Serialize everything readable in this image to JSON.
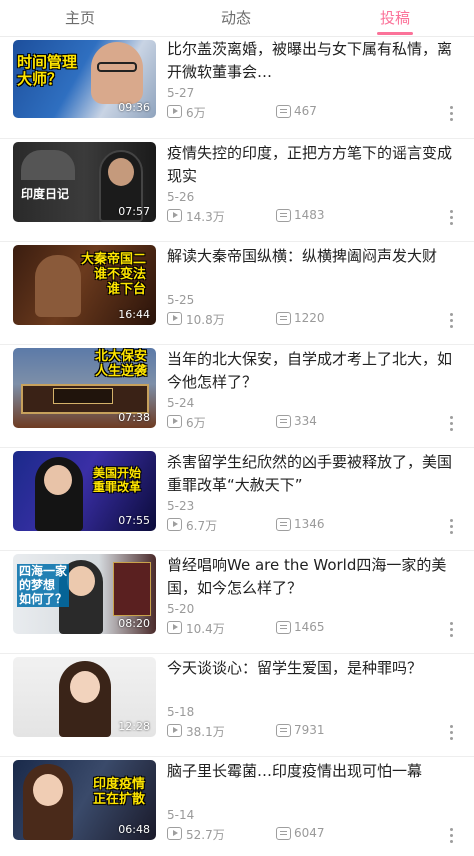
{
  "tabs": [
    {
      "label": "主页"
    },
    {
      "label": "动态"
    },
    {
      "label": "投稿",
      "active": true
    }
  ],
  "accent_color": "#fb7299",
  "videos": [
    {
      "title": "比尔盖茨离婚，被曝出与女下属有私情，离开微软董事会…",
      "date": "5-27",
      "views": "6万",
      "danmaku": "467",
      "duration": "09:36",
      "thumb_caption": "时间管理\n大师？"
    },
    {
      "title": "疫情失控的印度，正把方方笔下的谣言变成现实",
      "date": "5-26",
      "views": "14.3万",
      "danmaku": "1483",
      "duration": "07:57",
      "thumb_caption": "印度日记"
    },
    {
      "title": "解读大秦帝国纵横：纵横捭阖闷声发大财",
      "date": "5-25",
      "views": "10.8万",
      "danmaku": "1220",
      "duration": "16:44",
      "thumb_caption": "大秦帝国二\n谁不变法\n谁下台"
    },
    {
      "title": "当年的北大保安，自学成才考上了北大，如今他怎样了？",
      "date": "5-24",
      "views": "6万",
      "danmaku": "334",
      "duration": "07:38",
      "thumb_caption": "北大保安\n人生逆袭"
    },
    {
      "title": "杀害留学生纪欣然的凶手要被释放了，美国重罪改革“大赦天下”",
      "date": "5-23",
      "views": "6.7万",
      "danmaku": "1346",
      "duration": "07:55",
      "thumb_caption": "美国开始\n重罪改革"
    },
    {
      "title": "曾经唱响We are the World四海一家的美国，如今怎么样了？",
      "date": "5-20",
      "views": "10.4万",
      "danmaku": "1465",
      "duration": "08:20",
      "thumb_caption": "四海一家\n的梦想\n如何了？"
    },
    {
      "title": "今天谈谈心：留学生爱国，是种罪吗？",
      "date": "5-18",
      "views": "38.1万",
      "danmaku": "7931",
      "duration": "12:28",
      "thumb_caption": ""
    },
    {
      "title": "脑子里长霉菌…印度疫情出现可怕一幕",
      "date": "5-14",
      "views": "52.7万",
      "danmaku": "6047",
      "duration": "06:48",
      "thumb_caption": "印度疫情\n正在扩散"
    }
  ]
}
